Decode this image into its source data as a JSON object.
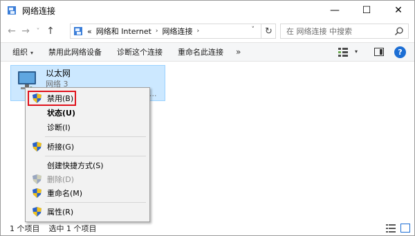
{
  "window": {
    "title": "网络连接",
    "controls": {
      "minimize": "—",
      "maximize": "☐",
      "close": "✕"
    }
  },
  "nav": {
    "back": "←",
    "forward": "→",
    "recent": "˅",
    "up": "↑",
    "breadcrumb": [
      "网络和 Internet",
      "网络连接"
    ],
    "prefix": "«",
    "sep": "›",
    "dropdown": "˅",
    "refresh": "↻",
    "search_placeholder": "在 网络连接 中搜索"
  },
  "toolbar": {
    "organize": "组织",
    "organize_caret": "▾",
    "disable": "禁用此网络设备",
    "diagnose": "诊断这个连接",
    "rename": "重命名此连接",
    "more": "»",
    "view_caret": "▾",
    "help": "?"
  },
  "connection": {
    "name": "以太网",
    "network": "网络 3",
    "device": "..."
  },
  "context_menu": {
    "items": [
      {
        "label": "禁用(B)",
        "icon": "shield-icon",
        "style": "normal"
      },
      {
        "label": "状态(U)",
        "icon": "",
        "style": "bold"
      },
      {
        "label": "诊断(I)",
        "icon": "",
        "style": "normal"
      },
      {
        "label": "桥接(G)",
        "icon": "shield-icon",
        "style": "normal"
      },
      {
        "label": "创建快捷方式(S)",
        "icon": "",
        "style": "normal"
      },
      {
        "label": "删除(D)",
        "icon": "shield-icon",
        "style": "disabled"
      },
      {
        "label": "重命名(M)",
        "icon": "shield-icon",
        "style": "normal"
      },
      {
        "label": "属性(R)",
        "icon": "shield-icon",
        "style": "normal"
      }
    ]
  },
  "status": {
    "count": "1 个项目",
    "selected": "选中 1 个项目"
  },
  "colors": {
    "selection_bg": "#cce8ff",
    "highlight_border": "#e0101a",
    "accent": "#1c6ed4"
  }
}
